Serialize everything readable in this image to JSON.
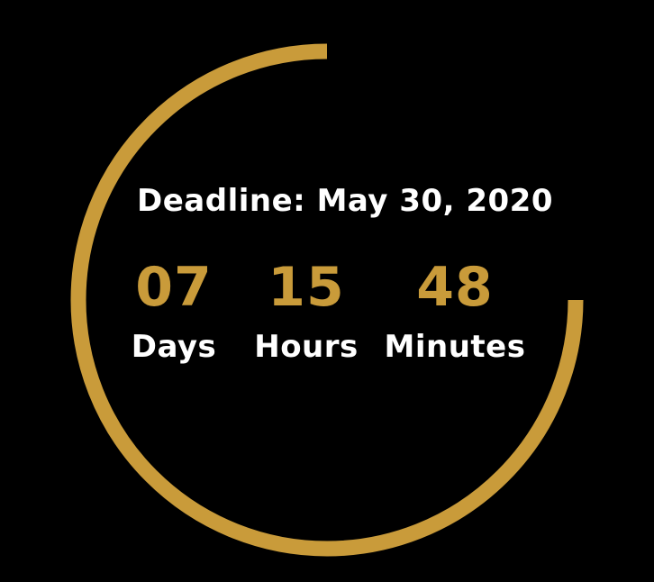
{
  "countdown": {
    "deadline_text": "Deadline: May 30, 2020",
    "accent_color": "#c99b3a",
    "text_color": "#ffffff",
    "background_color": "#000000",
    "progress_fraction": 0.75,
    "units": [
      {
        "value": "07",
        "label": "Days"
      },
      {
        "value": "15",
        "label": "Hours"
      },
      {
        "value": "48",
        "label": "Minutes"
      }
    ]
  }
}
